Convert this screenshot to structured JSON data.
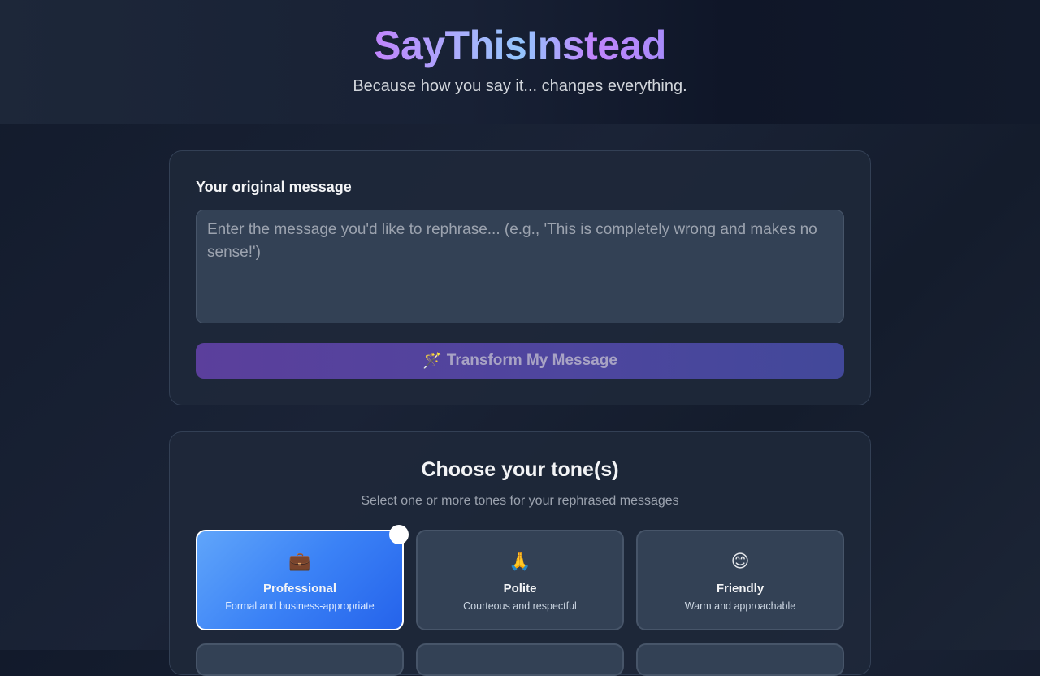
{
  "header": {
    "title": "SayThisInstead",
    "tagline": "Because how you say it... changes everything."
  },
  "input_card": {
    "label": "Your original message",
    "placeholder": "Enter the message you'd like to rephrase... (e.g., 'This is completely wrong and makes no sense!')",
    "value": "",
    "button_icon": "🪄",
    "button_label": "Transform My Message"
  },
  "tone_card": {
    "title": "Choose your tone(s)",
    "subtitle": "Select one or more tones for your rephrased messages",
    "tones": [
      {
        "emoji": "💼",
        "name": "Professional",
        "desc": "Formal and business-appropriate",
        "selected": true
      },
      {
        "emoji": "🙏",
        "name": "Polite",
        "desc": "Courteous and respectful",
        "selected": false
      },
      {
        "emoji": "😊",
        "name": "Friendly",
        "desc": "Warm and approachable",
        "selected": false
      }
    ]
  },
  "colors": {
    "accent_purple": "#c084fc",
    "accent_blue": "#3b82f6",
    "background": "#1a2336"
  }
}
